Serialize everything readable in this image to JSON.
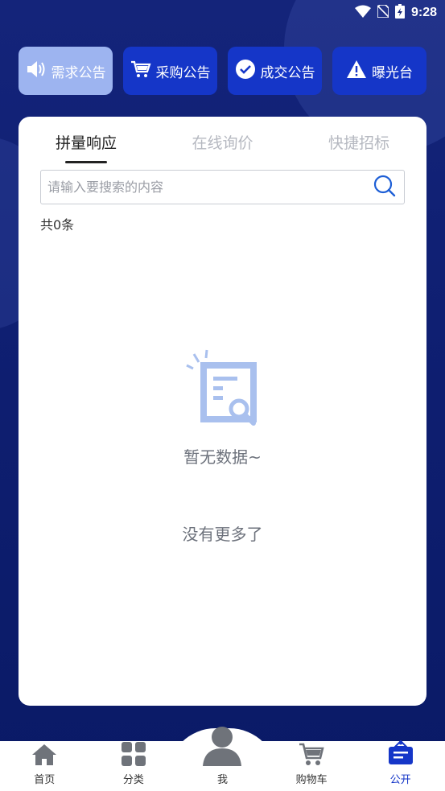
{
  "status": {
    "time": "9:28"
  },
  "top_buttons": [
    {
      "label": "需求公告",
      "icon": "speaker-icon",
      "active": true
    },
    {
      "label": "采购公告",
      "icon": "cart-icon",
      "active": false
    },
    {
      "label": "成交公告",
      "icon": "check-circle-icon",
      "active": false
    },
    {
      "label": "曝光台",
      "icon": "warning-icon",
      "active": false
    }
  ],
  "tabs": [
    {
      "label": "拼量响应",
      "active": true
    },
    {
      "label": "在线询价",
      "active": false
    },
    {
      "label": "快捷招标",
      "active": false
    }
  ],
  "search": {
    "placeholder": "请输入要搜索的内容"
  },
  "count_text": "共0条",
  "empty_text": "暂无数据~",
  "no_more_text": "没有更多了",
  "bottom_nav": [
    {
      "label": "首页",
      "icon": "home-icon"
    },
    {
      "label": "分类",
      "icon": "grid-icon"
    },
    {
      "label": "我",
      "icon": "person-icon"
    },
    {
      "label": "购物车",
      "icon": "cart-icon"
    },
    {
      "label": "公开",
      "icon": "notice-icon",
      "active": true
    }
  ],
  "colors": {
    "accent": "#1536c8",
    "active_button": "#9db4f0",
    "background": "#0b1a6b"
  }
}
